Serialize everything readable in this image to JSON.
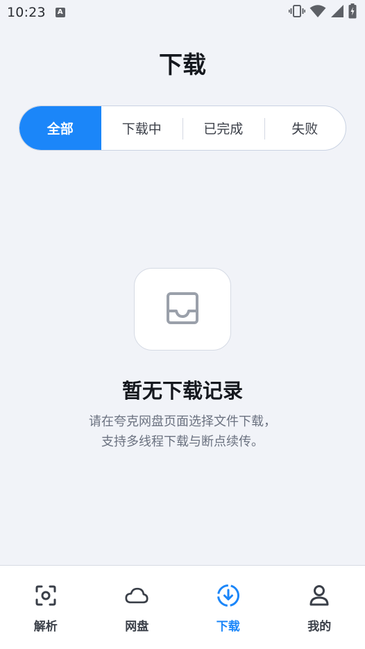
{
  "status_bar": {
    "time": "10:23",
    "notification_icon_letter": "A",
    "icons": [
      "vibrate-icon",
      "wifi-icon",
      "signal-icon",
      "battery-charging-icon"
    ]
  },
  "header": {
    "title": "下载"
  },
  "filter_tabs": {
    "items": [
      {
        "label": "全部",
        "active": true
      },
      {
        "label": "下载中",
        "active": false
      },
      {
        "label": "已完成",
        "active": false
      },
      {
        "label": "失败",
        "active": false
      }
    ]
  },
  "empty_state": {
    "icon": "inbox-icon",
    "title": "暂无下载记录",
    "description_line1": "请在夸克网盘页面选择文件下载，",
    "description_line2": "支持多线程下载与断点续传。"
  },
  "bottom_nav": {
    "items": [
      {
        "label": "解析",
        "icon": "scan-icon",
        "active": false
      },
      {
        "label": "网盘",
        "icon": "cloud-icon",
        "active": false
      },
      {
        "label": "下载",
        "icon": "download-icon",
        "active": true
      },
      {
        "label": "我的",
        "icon": "user-icon",
        "active": false
      }
    ]
  },
  "colors": {
    "accent": "#1b86f9",
    "background": "#f1f3f8",
    "text_primary": "#15181e",
    "text_secondary": "#6b7280"
  }
}
